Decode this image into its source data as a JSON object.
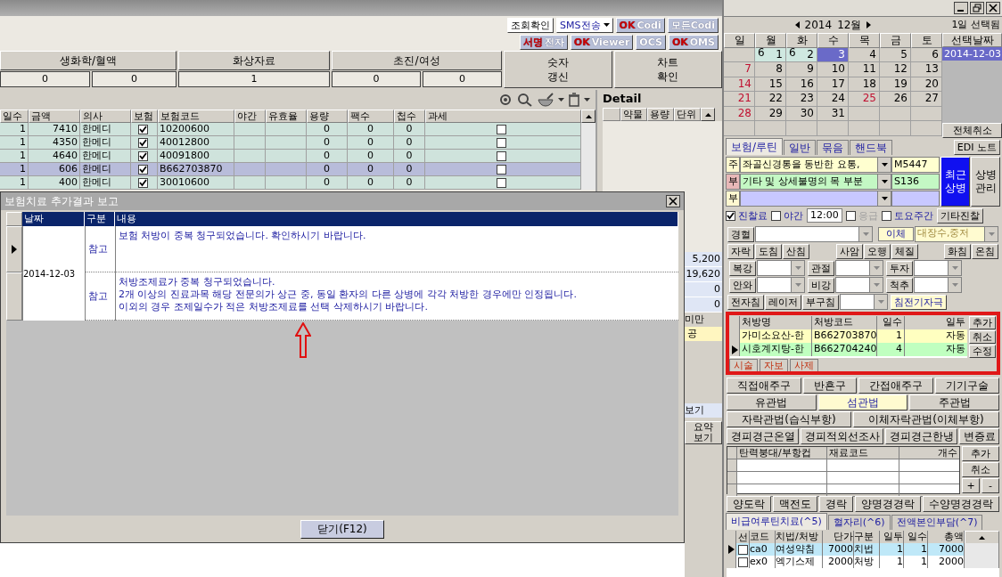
{
  "toolbar": {
    "row_1": [
      {
        "label": "조회확인",
        "kind": "plain"
      },
      {
        "label": "SMS전송",
        "kind": "dropdown"
      },
      {
        "prefix": "OK",
        "label": "Codi",
        "kind": "logo"
      },
      {
        "label": "모든Codi",
        "kind": "logo"
      }
    ],
    "row_2": [
      {
        "prefix": "서명",
        "label": "전자",
        "kind": "logo"
      },
      {
        "prefix": "OK",
        "label": "Viewer",
        "kind": "logo"
      },
      {
        "label": "OCS",
        "kind": "logo"
      },
      {
        "prefix": "OK",
        "label": "OMS",
        "kind": "logo"
      }
    ]
  },
  "summary": {
    "headers": [
      "생화학/혈액",
      "화상자료",
      "초진/여성"
    ],
    "values": [
      "0",
      "0",
      "1",
      "0",
      "0"
    ],
    "buttons": [
      [
        "숫자",
        "갱신"
      ],
      [
        "차트",
        "확인"
      ]
    ]
  },
  "treatment_table": {
    "columns": [
      "일수",
      "금액",
      "의사",
      "보험",
      "보험코드",
      "야간",
      "유효율",
      "용량",
      "팩수",
      "첩수",
      "과세"
    ],
    "rows": [
      {
        "days": "1",
        "amount": "7410",
        "doctor": "한메디",
        "insured": true,
        "code": "10200600",
        "dose": "0",
        "packs": "0",
        "portions": "0",
        "taxed": false,
        "selected": false
      },
      {
        "days": "1",
        "amount": "4350",
        "doctor": "한메디",
        "insured": true,
        "code": "40012800",
        "dose": "0",
        "packs": "0",
        "portions": "0",
        "taxed": false,
        "selected": false
      },
      {
        "days": "1",
        "amount": "4640",
        "doctor": "한메디",
        "insured": true,
        "code": "40091800",
        "dose": "0",
        "packs": "0",
        "portions": "0",
        "taxed": false,
        "selected": false
      },
      {
        "days": "1",
        "amount": "606",
        "doctor": "한메디",
        "insured": true,
        "code": "B662703870",
        "dose": "0",
        "packs": "0",
        "portions": "0",
        "taxed": false,
        "selected": true
      },
      {
        "days": "1",
        "amount": "400",
        "doctor": "한메디",
        "insured": true,
        "code": "30010600",
        "dose": "0",
        "packs": "0",
        "portions": "0",
        "taxed": false,
        "selected": false
      }
    ]
  },
  "detail": {
    "title": "Detail",
    "columns": [
      "약물",
      "용량",
      "단위"
    ]
  },
  "side_values": {
    "totals": [
      "5,200",
      "19,620",
      "0",
      "0"
    ],
    "note": "미만",
    "tag": "공",
    "link": "보기",
    "button": [
      "요약",
      "보기"
    ]
  },
  "dialog": {
    "title": "보험치료 추가결과 보고",
    "columns": [
      "날짜",
      "구분",
      "내용"
    ],
    "date": "2014-12-03",
    "rows": [
      {
        "type": "참고",
        "lines": [
          "보험 처방이 중복 청구되었습니다. 확인하시기 바랍니다."
        ],
        "current": true
      },
      {
        "type": "참고",
        "lines": [
          "처방조제료가 중복 청구되었습니다.",
          "2개 이상의 진료과목 해당 전문의가 상근 중, 동일 환자의 다른 상병에 각각 처방한 경우에만 인정됩니다.",
          "이외의 경우 조제일수가 적은 처방조제료를 선택 삭제하시기 바랍니다."
        ],
        "current": false
      }
    ],
    "close_button": "닫기(F12)"
  },
  "calendar": {
    "year": "2014",
    "month": "12월",
    "status": "1일 선택됨",
    "weekdays": [
      "일",
      "월",
      "화",
      "수",
      "목",
      "금",
      "토"
    ],
    "side_header": "선택날짜",
    "selected_dates": [
      {
        "label": "2014-12-03",
        "selected": true
      }
    ],
    "clear_button": "전체취소",
    "weeks": [
      [
        {
          "kind": "blank"
        },
        {
          "kind": "day",
          "day": "1",
          "count": "6",
          "selected": false,
          "holiday": false
        },
        {
          "kind": "day",
          "day": "2",
          "count": "6",
          "selected": false,
          "holiday": false
        },
        {
          "kind": "day",
          "day": "3",
          "selected": true,
          "holiday": false
        },
        {
          "kind": "day",
          "day": "4",
          "selected": false,
          "holiday": false
        },
        {
          "kind": "day",
          "day": "5",
          "selected": false,
          "holiday": false
        },
        {
          "kind": "day",
          "day": "6",
          "selected": false,
          "holiday": false
        }
      ],
      [
        {
          "kind": "day",
          "day": "7",
          "selected": false,
          "holiday": true
        },
        {
          "kind": "day",
          "day": "8",
          "selected": false,
          "holiday": false
        },
        {
          "kind": "day",
          "day": "9",
          "selected": false,
          "holiday": false
        },
        {
          "kind": "day",
          "day": "10",
          "selected": false,
          "holiday": false
        },
        {
          "kind": "day",
          "day": "11",
          "selected": false,
          "holiday": false
        },
        {
          "kind": "day",
          "day": "12",
          "selected": false,
          "holiday": false
        },
        {
          "kind": "day",
          "day": "13",
          "selected": false,
          "holiday": false
        }
      ],
      [
        {
          "kind": "day",
          "day": "14",
          "selected": false,
          "holiday": true
        },
        {
          "kind": "day",
          "day": "15",
          "selected": false,
          "holiday": false
        },
        {
          "kind": "day",
          "day": "16",
          "selected": false,
          "holiday": false
        },
        {
          "kind": "day",
          "day": "17",
          "selected": false,
          "holiday": false
        },
        {
          "kind": "day",
          "day": "18",
          "selected": false,
          "holiday": false
        },
        {
          "kind": "day",
          "day": "19",
          "selected": false,
          "holiday": false
        },
        {
          "kind": "day",
          "day": "20",
          "selected": false,
          "holiday": false
        }
      ],
      [
        {
          "kind": "day",
          "day": "21",
          "selected": false,
          "holiday": true
        },
        {
          "kind": "day",
          "day": "22",
          "selected": false,
          "holiday": false
        },
        {
          "kind": "day",
          "day": "23",
          "selected": false,
          "holiday": false
        },
        {
          "kind": "day",
          "day": "24",
          "selected": false,
          "holiday": false
        },
        {
          "kind": "day",
          "day": "25",
          "selected": false,
          "holiday": true
        },
        {
          "kind": "day",
          "day": "26",
          "selected": false,
          "holiday": false
        },
        {
          "kind": "day",
          "day": "27",
          "selected": false,
          "holiday": false
        }
      ],
      [
        {
          "kind": "day",
          "day": "28",
          "selected": false,
          "holiday": true
        },
        {
          "kind": "day",
          "day": "29",
          "selected": false,
          "holiday": false
        },
        {
          "kind": "day",
          "day": "30",
          "selected": false,
          "holiday": false
        },
        {
          "kind": "day",
          "day": "31",
          "selected": false,
          "holiday": false
        },
        {
          "kind": "blank"
        },
        {
          "kind": "blank"
        },
        {
          "kind": "blank"
        }
      ],
      [
        {
          "kind": "blank"
        },
        {
          "kind": "blank"
        },
        {
          "kind": "blank"
        },
        {
          "kind": "blank"
        },
        {
          "kind": "blank"
        },
        {
          "kind": "blank"
        },
        {
          "kind": "blank"
        }
      ]
    ]
  },
  "tabs": [
    {
      "label": "보험/루틴",
      "selected": true
    },
    {
      "label": "일반",
      "selected": false
    },
    {
      "label": "묶음",
      "selected": false
    },
    {
      "label": "핸드북",
      "selected": false
    }
  ],
  "edi_button": "EDI 노트",
  "diagnoses": [
    {
      "role": "주",
      "name": "좌골신경통을 동반한 요통,",
      "code": "M5447",
      "color": "#ffffd0"
    },
    {
      "role": "부",
      "name": "기타 및 상세불명의 목 부분",
      "code": "S136",
      "color": "#c4f8c4"
    },
    {
      "role": "부",
      "color": "#c8c8ff"
    }
  ],
  "diagnosis_buttons": [
    [
      "최근",
      "상병"
    ],
    [
      "상병",
      "관리"
    ]
  ],
  "visit_options": [
    {
      "kind": "check",
      "label": "진찰료",
      "checked": true,
      "disabled": false
    },
    {
      "kind": "check",
      "label": "야간",
      "checked": false,
      "disabled": false
    },
    {
      "kind": "time",
      "value": "12:00"
    },
    {
      "kind": "check",
      "label": "응급",
      "checked": false,
      "disabled": true
    },
    {
      "kind": "check",
      "label": "토요주간",
      "checked": false,
      "disabled": false
    },
    {
      "kind": "button",
      "label": "기타진찰"
    }
  ],
  "acupoint": {
    "button": "경혈",
    "transfer_label": "이체",
    "transfer_value": "대장수,중저"
  },
  "needle_buttons": [
    [
      "자락",
      "도침",
      "산침"
    ],
    [
      "사암",
      "오행",
      "체질"
    ],
    [
      "화침",
      "온침"
    ]
  ],
  "region_rows": [
    [
      "복강",
      "관절",
      "투자"
    ],
    [
      "안와",
      "비강",
      "척추"
    ]
  ],
  "device_row": {
    "buttons": [
      "전자침",
      "레이저",
      "부구침"
    ],
    "action": "침전기자극"
  },
  "prescriptions": {
    "columns": [
      "처방명",
      "처방코드",
      "일수",
      "일투"
    ],
    "rows": [
      {
        "name": "가미소요산-한",
        "code": "B662703870",
        "days": "1",
        "dose": "자동",
        "selected": false,
        "color": "#ffffc0"
      },
      {
        "name": "시호계지탕-한",
        "code": "B662704240",
        "days": "4",
        "dose": "자동",
        "selected": true,
        "color": "#c0ffc0"
      }
    ],
    "buttons": [
      "추가",
      "취소",
      "수정"
    ],
    "tabs": [
      "시술",
      "자보",
      "사제"
    ]
  },
  "procedure_rows": [
    [
      {
        "label": "직접애주구",
        "selected": false
      },
      {
        "label": "반흔구",
        "selected": false
      },
      {
        "label": "간접애주구",
        "selected": false
      },
      {
        "label": "기기구술",
        "selected": false
      }
    ],
    [
      {
        "label": "유관법",
        "selected": false
      },
      {
        "label": "섬관법",
        "selected": true
      },
      {
        "label": "주관법",
        "selected": false
      }
    ],
    [
      {
        "label": "자락관법(습식부항)",
        "selected": false
      },
      {
        "label": "이체자락관법(이체부항)",
        "selected": false
      }
    ],
    [
      {
        "label": "경피경근온열",
        "selected": false
      },
      {
        "label": "경피적외선조사",
        "selected": false
      },
      {
        "label": "경피경근한냉",
        "selected": false
      },
      {
        "label": "변증료",
        "selected": false
      }
    ]
  ],
  "materials": {
    "columns": [
      "탄력붕대/부항컵",
      "재료코드",
      "개수"
    ],
    "buttons": [
      "추가",
      "취소",
      "+",
      "-"
    ]
  },
  "meridian_buttons": [
    "양도락",
    "맥전도",
    "경락",
    "양명경경락",
    "수양명경경락"
  ],
  "bottom_tabs": [
    {
      "label": "비급여루틴치료(^5)",
      "selected": true
    },
    {
      "label": "혈자리(^6)",
      "selected": false
    },
    {
      "label": "전액본인부담(^7)",
      "selected": false
    }
  ],
  "nonbenefit": {
    "columns": [
      "선",
      "코드",
      "치법/처방",
      "단가",
      "구분",
      "일투",
      "일수",
      "총액"
    ],
    "rows": [
      {
        "checked": false,
        "code": "ca0",
        "name": "여성약침",
        "price": "7000",
        "type": "치법",
        "dose": "1",
        "days": "1",
        "total": "7000",
        "selected": true
      },
      {
        "checked": false,
        "code": "ex0",
        "name": "엑기스제",
        "price": "2000",
        "type": "처방",
        "dose": "1",
        "days": "1",
        "total": "2000",
        "selected": false
      }
    ]
  }
}
